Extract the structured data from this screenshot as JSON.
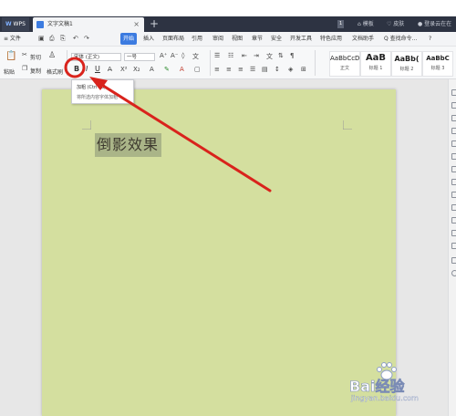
{
  "titlebar": {
    "wps_tab": "WPS",
    "doc_tab": "文字文稿1",
    "new_tab": "+",
    "badge": "1",
    "template": "模板",
    "skin": "皮肤",
    "user": "登录云在在"
  },
  "menu": {
    "file": "≡ 文件",
    "items": [
      "开始",
      "插入",
      "页面布局",
      "引用",
      "审阅",
      "视图",
      "章节",
      "安全",
      "开发工具",
      "特色应用",
      "文档助手"
    ],
    "search": "Q 查找命令...",
    "help": "?"
  },
  "ribbon": {
    "cut": "剪切",
    "paste": "粘贴",
    "copy": "复制",
    "format_painter": "格式刷",
    "font_name": "宋体 (正文)",
    "font_size": "一号",
    "bold": "B",
    "italic": "I",
    "underline": "U",
    "styles": [
      {
        "preview": "AaBbCcDd",
        "name": "正文"
      },
      {
        "preview": "AaB",
        "name": "标题 1"
      },
      {
        "preview": "AaBb(",
        "name": "标题 2"
      },
      {
        "preview": "AaBbC",
        "name": "标题 3"
      }
    ]
  },
  "tooltip": {
    "title": "加粗 (Ctrl+B)",
    "desc": "将所选内容字体加粗"
  },
  "document": {
    "text": "倒影效果"
  },
  "annotation": {
    "color": "#d9231c"
  },
  "watermark": {
    "brand": "Bai经验",
    "url": "jingyan.baidu.com"
  },
  "colors": {
    "titlebar": "#2d3342",
    "accent": "#3c7be0",
    "page": "#d4df9f",
    "highlight": "#aab588"
  }
}
